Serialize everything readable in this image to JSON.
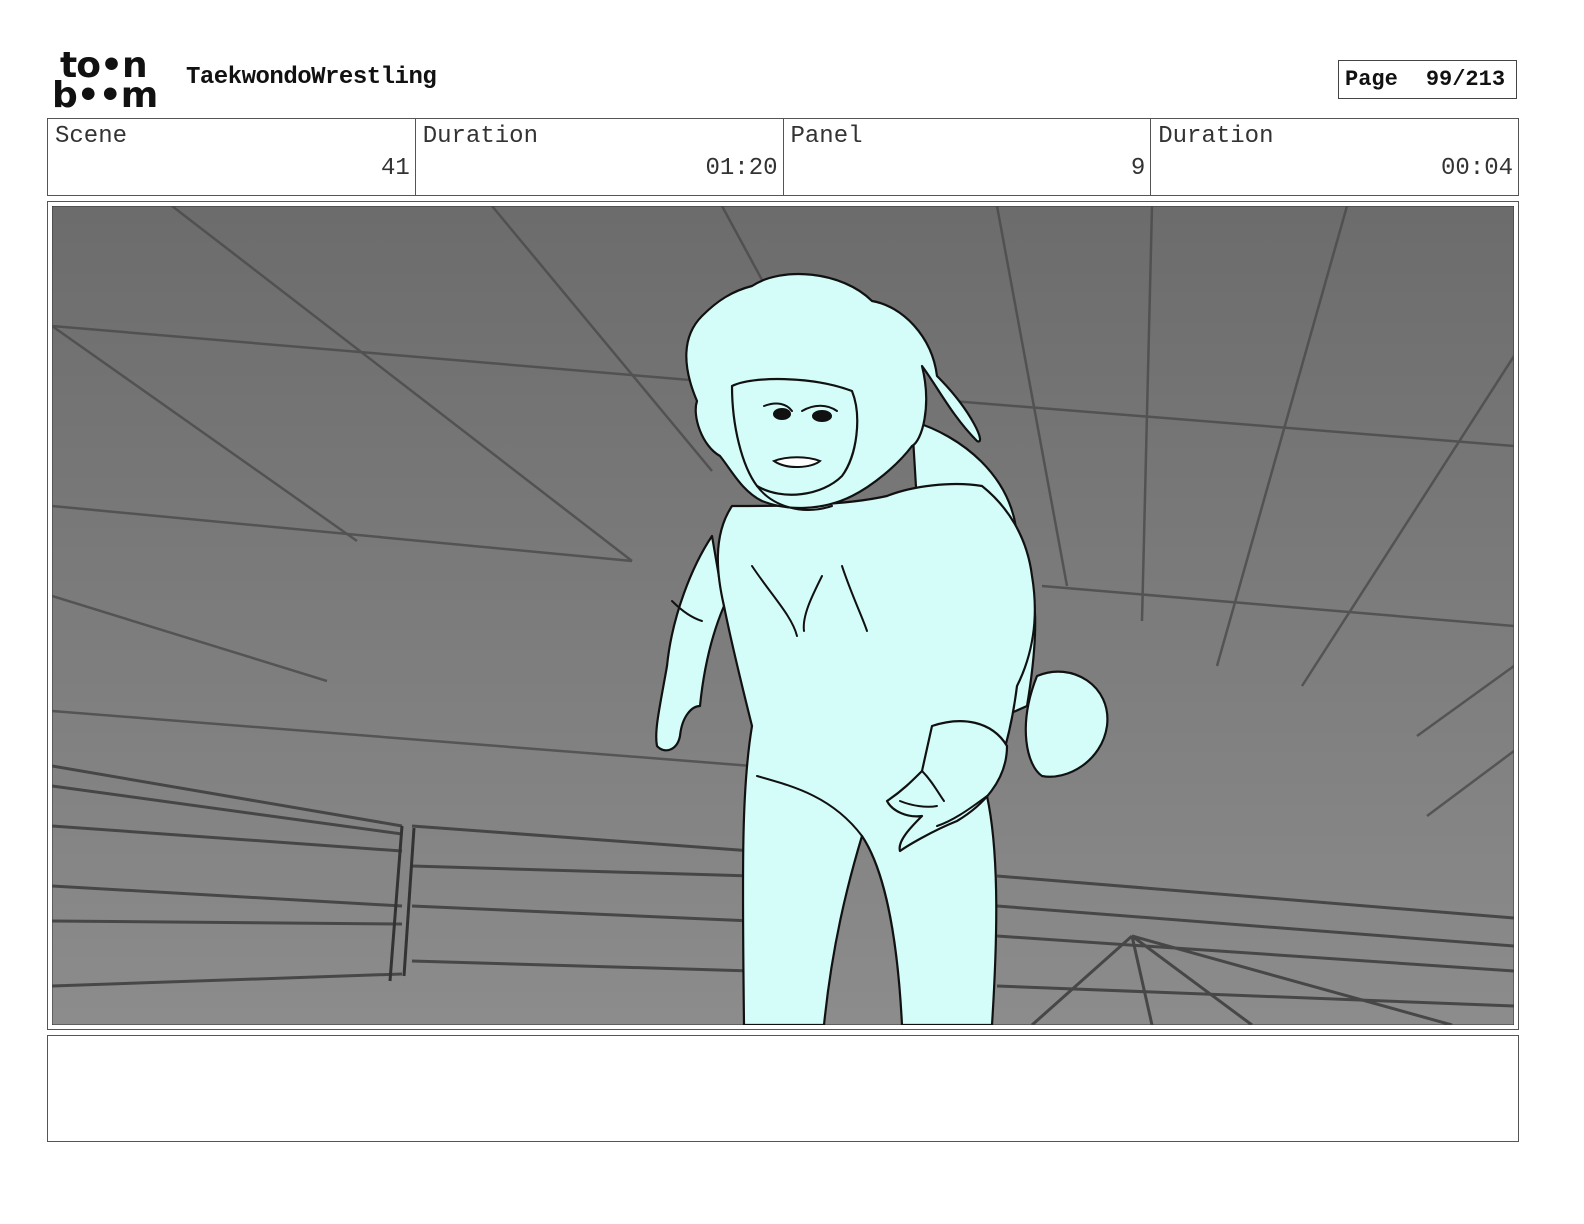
{
  "header": {
    "logo_top": "to•n",
    "logo_bottom": "b••m",
    "project_title": "TaekwondoWrestling",
    "page_label": "Page",
    "page_number": "99/213"
  },
  "info": [
    {
      "label": "Scene",
      "value": "41"
    },
    {
      "label": "Duration",
      "value": "01:20"
    },
    {
      "label": "Panel",
      "value": "9"
    },
    {
      "label": "Duration",
      "value": "00:04"
    }
  ],
  "colors": {
    "figure_fill": "#d4fdf9",
    "bg_top": "#6e6e6e",
    "bg_bottom": "#8a8a8a",
    "line": "#111111"
  },
  "notes": ""
}
